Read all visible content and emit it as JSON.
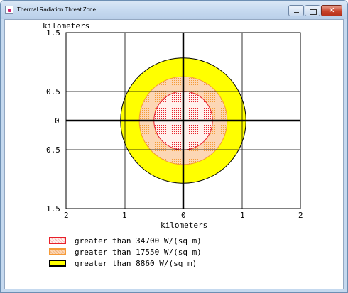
{
  "window": {
    "title": "Thermal Radiation Threat Zone",
    "icon": "app-icon",
    "controls": {
      "minimize": "minimize-icon",
      "maximize": "maximize-icon",
      "close": "close-icon"
    }
  },
  "plot": {
    "y_unit_label": "kilometers",
    "x_unit_label": "kilometers",
    "y_ticks": [
      "1.5",
      "0.5",
      "0",
      "0.5",
      "1.5"
    ],
    "x_ticks": [
      "2",
      "1",
      "0",
      "1",
      "2"
    ]
  },
  "legend": [
    {
      "label": "greater than 34700 W/(sq m)",
      "fill": "#fff0ec",
      "border": "#e8202a",
      "pattern": "dotted-red"
    },
    {
      "label": "greater than 17550 W/(sq m)",
      "fill": "#fcd6b4",
      "border": "#f59a36",
      "pattern": "dotted-orange"
    },
    {
      "label": "greater than 8860 W/(sq m)",
      "fill": "#ffff00",
      "border": "#000000",
      "pattern": "solid"
    }
  ],
  "zones": [
    {
      "radius_km": 1.07,
      "fill": "#ffff00",
      "stroke": "#000000"
    },
    {
      "radius_km": 0.75,
      "fill": "#fcd6b4",
      "stroke": "#f59a36"
    },
    {
      "radius_km": 0.5,
      "fill": "#fff0ec",
      "stroke": "#e8202a"
    }
  ],
  "colors": {
    "axis": "#000000",
    "grid": "#000000",
    "window_frame": "#c5d9ef"
  }
}
